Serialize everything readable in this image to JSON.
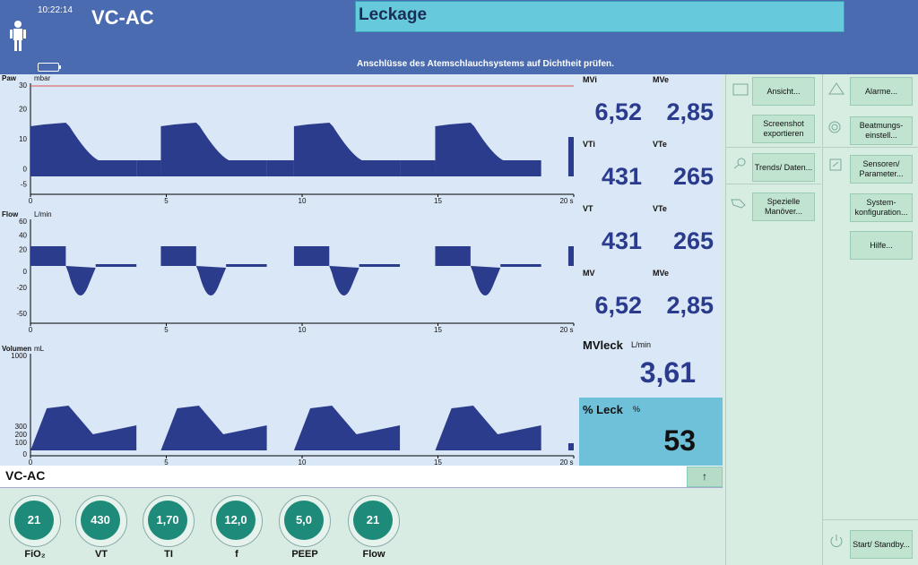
{
  "header": {
    "time": "10:22:14",
    "mode": "VC-AC",
    "alarm_title": "Leckage",
    "alarm_hint": "Anschlüsse des Atemschlauchsystems auf Dichtheit prüfen."
  },
  "waves": [
    {
      "name": "Paw",
      "unit": "mbar",
      "yticks": [
        "30",
        "20",
        "10",
        "0",
        "-5"
      ]
    },
    {
      "name": "Flow",
      "unit": "L/min",
      "yticks": [
        "60",
        "40",
        "20",
        "0",
        "-20",
        "-50"
      ]
    },
    {
      "name": "Volumen",
      "unit": "mL",
      "yticks": [
        "1000",
        "300",
        "200",
        "100",
        "0"
      ]
    }
  ],
  "xticks": [
    "0",
    "5",
    "10",
    "15",
    "20 s"
  ],
  "measurements": [
    {
      "label": "MVi",
      "value": "6,52"
    },
    {
      "label": "MVe",
      "value": "2,85"
    },
    {
      "label": "VTi",
      "value": "431"
    },
    {
      "label": "VTe",
      "value": "265"
    },
    {
      "label": "VT",
      "value": "431"
    },
    {
      "label": "VTe",
      "value": "265"
    },
    {
      "label": "MV",
      "value": "6,52"
    },
    {
      "label": "MVe",
      "value": "2,85"
    }
  ],
  "mvleck": {
    "label": "MVleck",
    "unit": "L/min",
    "value": "3,61"
  },
  "leck": {
    "label": "% Leck",
    "unit": "%",
    "value": "53"
  },
  "modebar": {
    "label": "VC-AC",
    "arrow": "↑"
  },
  "knobs": [
    {
      "label": "FiO₂",
      "value": "21"
    },
    {
      "label": "VT",
      "value": "430"
    },
    {
      "label": "TI",
      "value": "1,70"
    },
    {
      "label": "f",
      "value": "12,0"
    },
    {
      "label": "PEEP",
      "value": "5,0"
    },
    {
      "label": "Flow",
      "value": "21"
    }
  ],
  "menu_col1": [
    "Ansicht...",
    "Screenshot exportieren",
    "Trends/ Daten...",
    "Spezielle Manöver..."
  ],
  "menu_col2": [
    "Alarme...",
    "Beatmungs-einstell...",
    "Sensoren/ Parameter...",
    "System-konfiguration...",
    "Hilfe..."
  ],
  "standby": "Start/ Standby...",
  "colors": {
    "header": "#4a6bb0",
    "wave_fill": "#2c3c8c",
    "alarm": "#66c9dc",
    "knob": "#1d8a7a"
  }
}
